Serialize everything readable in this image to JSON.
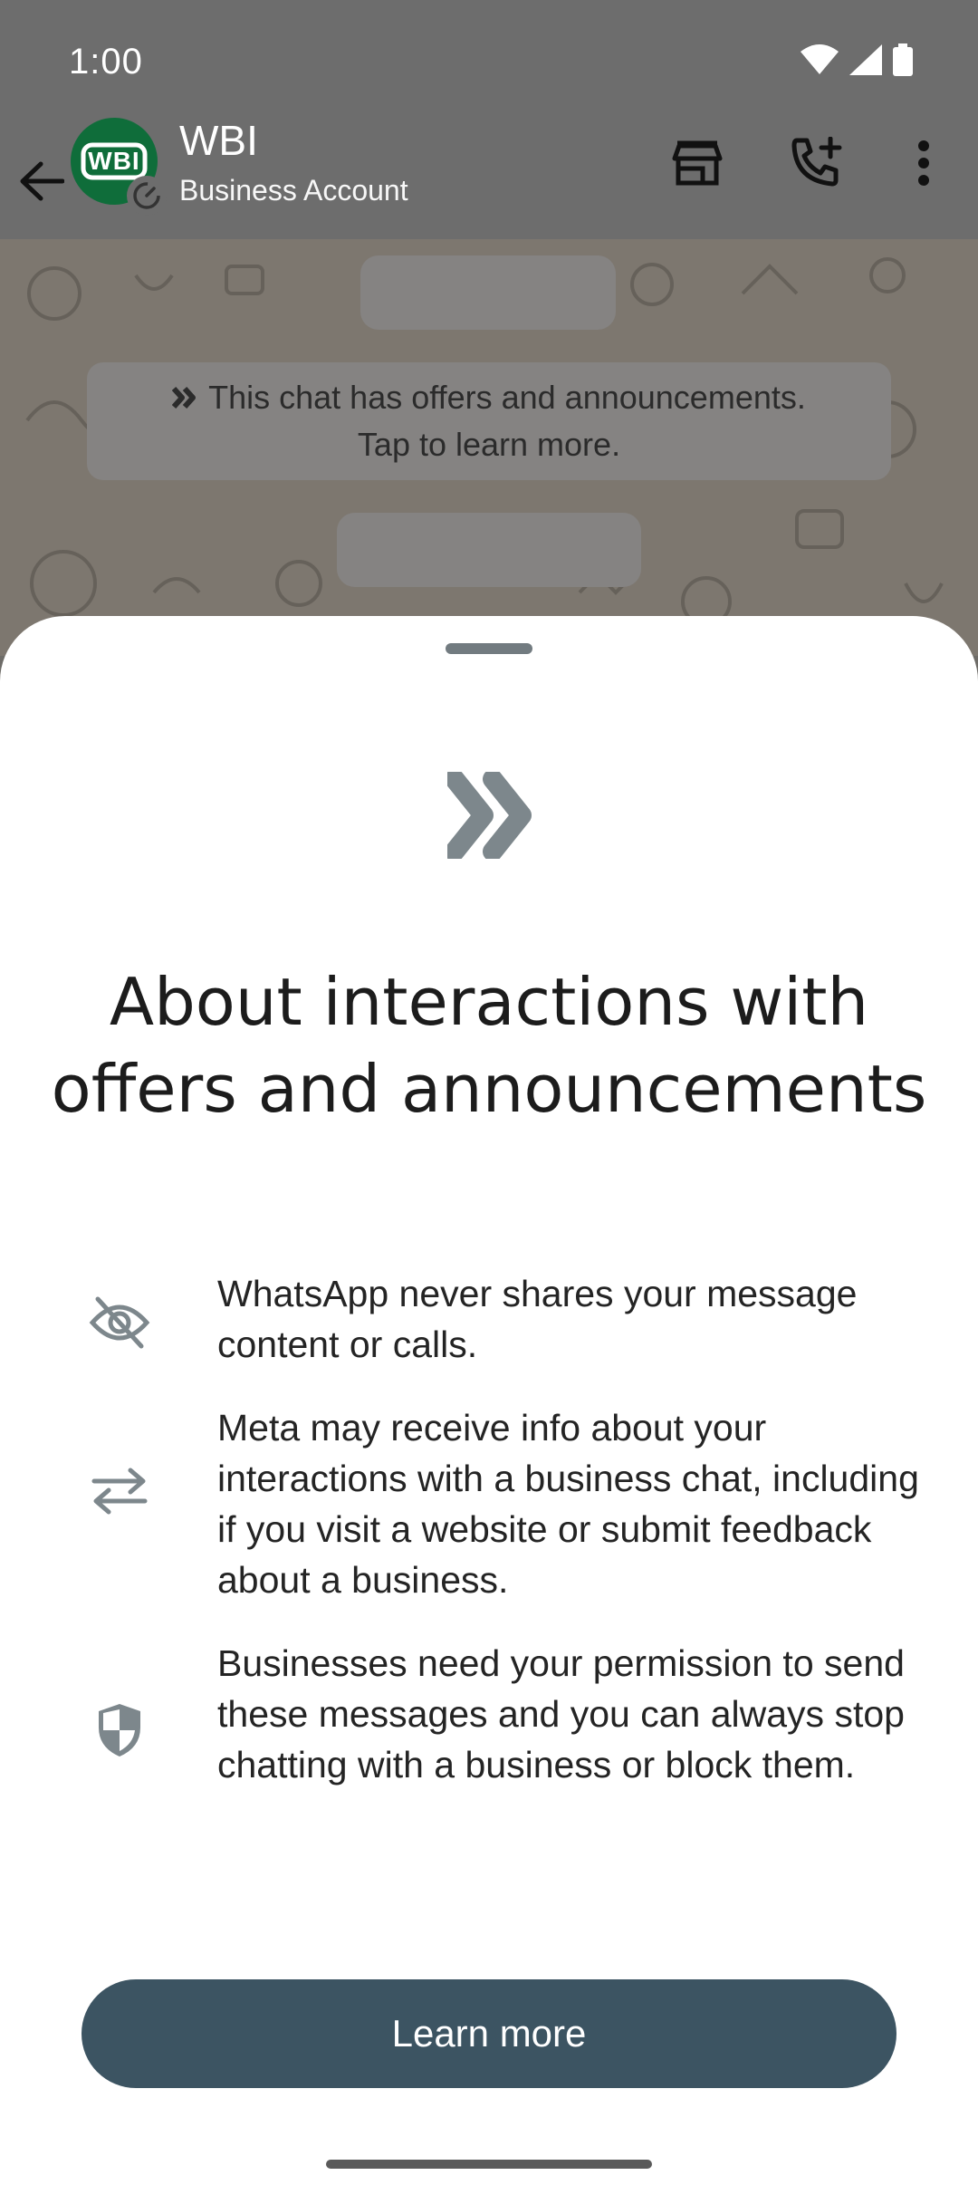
{
  "status_bar": {
    "time": "1:00",
    "icons": [
      "wifi-icon",
      "signal-icon",
      "battery-icon"
    ]
  },
  "app_bar": {
    "avatar_text": "WBI",
    "title": "WBI",
    "subtitle": "Business Account",
    "actions": [
      "storefront-icon",
      "add-call-icon",
      "more-vert-icon"
    ]
  },
  "chat": {
    "system_message_line1": "This chat has offers and announcements.",
    "system_message_line2": "Tap to learn more."
  },
  "sheet": {
    "title_line1": "About interactions with",
    "title_line2": "offers and announcements",
    "items": [
      {
        "icon": "eye-off-icon",
        "text": "WhatsApp never shares your message content or calls."
      },
      {
        "icon": "swap-arrows-icon",
        "text": "Meta may receive info about your interactions with a business chat, including if you visit a website or submit feedback about a business."
      },
      {
        "icon": "shield-icon",
        "text": "Businesses need your permission to send these messages and you can always stop chatting with a business or block them."
      }
    ],
    "button_label": "Learn more"
  },
  "colors": {
    "button_bg": "#3c5462",
    "avatar_bg": "#0f6d3a",
    "icon_gray": "#7d878c"
  }
}
